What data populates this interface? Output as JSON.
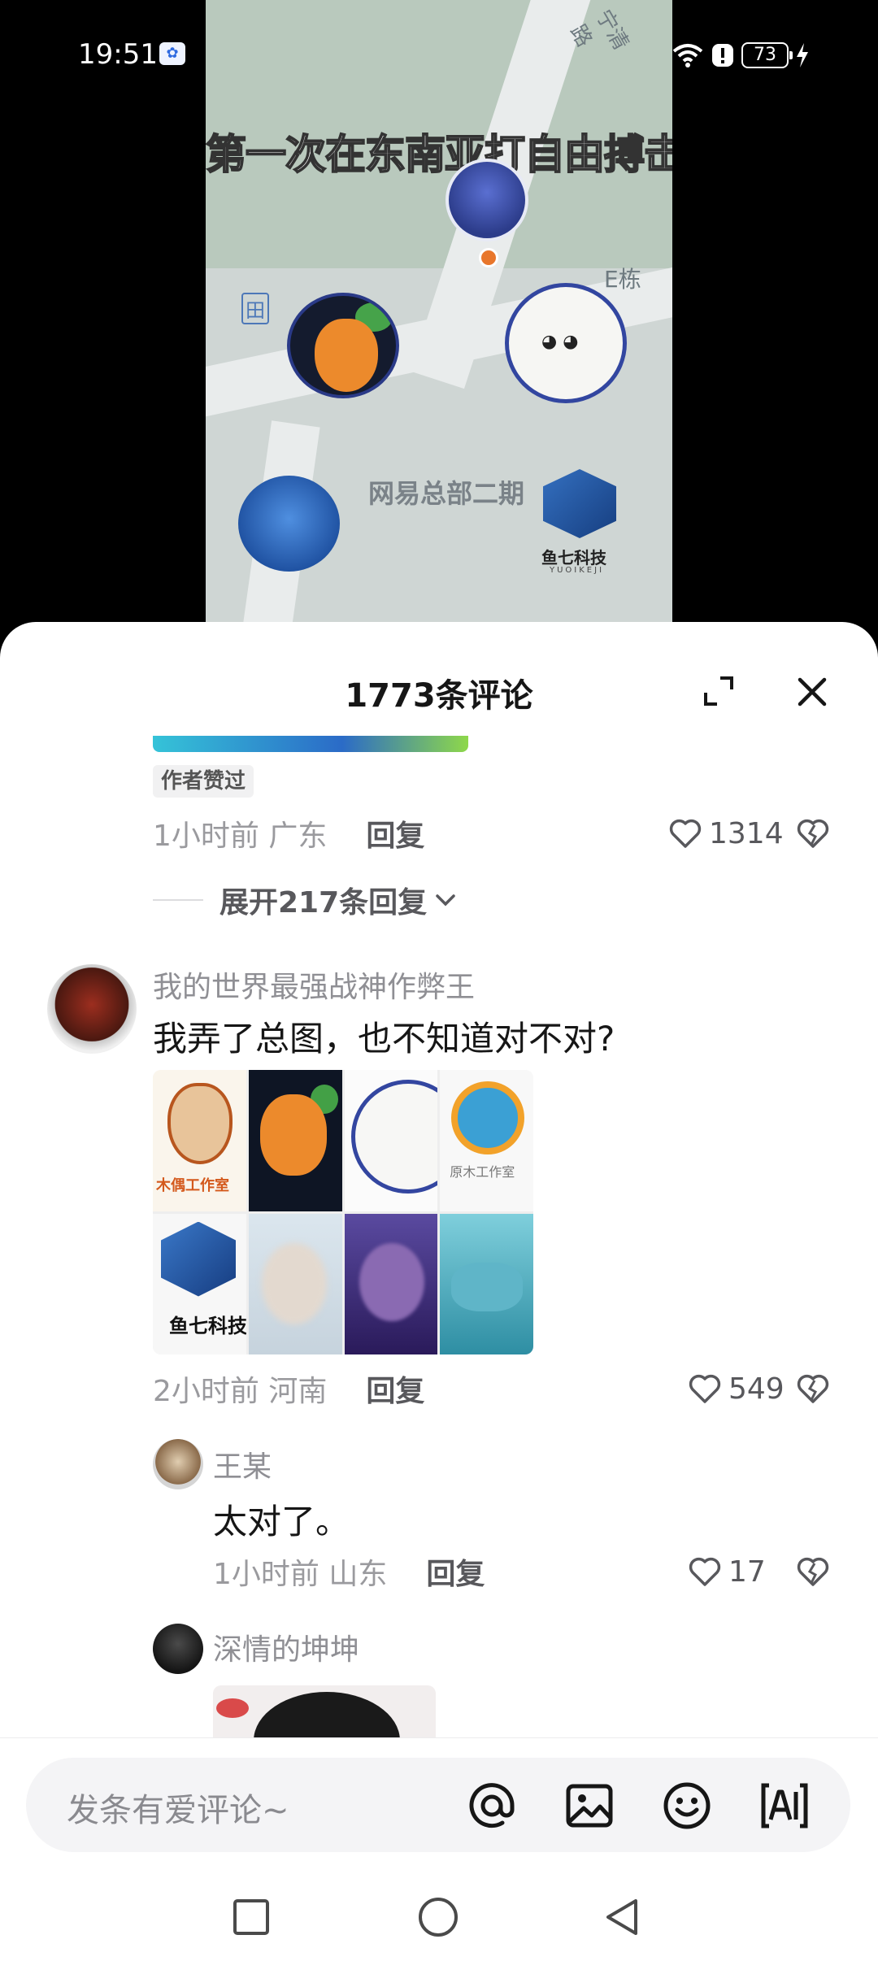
{
  "status_bar": {
    "time": "19:51",
    "app_icon": "baidu-icon",
    "battery": "73"
  },
  "video": {
    "caption": "第一次在东南亚打自由搏击",
    "map_labels": {
      "road": "宁清路",
      "building_e": "E栋",
      "headquarters": "网易总部二期",
      "poi_icon": "田"
    },
    "watermark": {
      "brand": "鱼七科技",
      "brand_en": "YUOIKEJI"
    }
  },
  "sheet": {
    "title": "1773条评论",
    "expand_icon": "expand-icon",
    "close_icon": "close-icon"
  },
  "comments": {
    "prev": {
      "badge": "作者赞过",
      "time_location": "1小时前 广东",
      "reply_label": "回复",
      "likes": "1314",
      "expand_replies": "展开217条回复"
    },
    "main": {
      "username": "我的世界最强战神作弊王",
      "text": "我弄了总图，也不知道对不对?",
      "grid_captions": {
        "tile1": "木偶工作室",
        "tile4": "原木工作室",
        "tile5": "鱼七科技"
      },
      "time_location": "2小时前 河南",
      "reply_label": "回复",
      "likes": "549"
    },
    "reply1": {
      "username": "王某",
      "text": "太对了。",
      "time_location": "1小时前 山东",
      "reply_label": "回复",
      "likes": "17"
    },
    "reply2": {
      "username": "深情的坤坤"
    }
  },
  "composer": {
    "placeholder": "发条有爱评论~",
    "icons": [
      "at-icon",
      "image-icon",
      "emoji-icon",
      "ai-icon"
    ]
  },
  "nav": {
    "icons": [
      "recents-square-icon",
      "home-circle-icon",
      "back-triangle-icon"
    ]
  },
  "colors": {
    "accent_text": "#58585c",
    "muted_text": "#9a9a9e",
    "sheet_bg": "#ffffff"
  }
}
